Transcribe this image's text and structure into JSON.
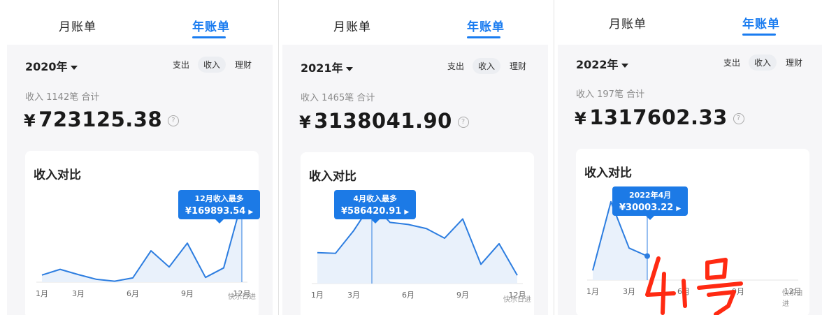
{
  "colors": {
    "accent": "#1a7cf0",
    "line": "#2c7de0",
    "fill": "#e9f1fb",
    "handwriting": "#ff2a12"
  },
  "panels": [
    {
      "tabs": [
        "月账单",
        "年账单"
      ],
      "year": "2020年",
      "segments": [
        "支出",
        "收入",
        "理财"
      ],
      "active_segment": "收入",
      "summary": "收入 1142笔 合计",
      "yen": "¥",
      "total": "723125.38",
      "help": "?",
      "card_title": "收入对比",
      "tooltip_title": "12月收入最多",
      "tooltip_value": "¥169893.54",
      "tooltip_arrow": "▶",
      "watermark": "快乐日进"
    },
    {
      "tabs": [
        "月账单",
        "年账单"
      ],
      "year": "2021年",
      "segments": [
        "支出",
        "收入",
        "理财"
      ],
      "active_segment": "收入",
      "summary": "收入 1465笔 合计",
      "yen": "¥",
      "total": "3138041.90",
      "help": "?",
      "card_title": "收入对比",
      "tooltip_title": "4月收入最多",
      "tooltip_value": "¥586420.91",
      "tooltip_arrow": "▶",
      "watermark": "快乐日进"
    },
    {
      "tabs": [
        "月账单",
        "年账单"
      ],
      "year": "2022年",
      "segments": [
        "支出",
        "收入",
        "理财"
      ],
      "active_segment": "收入",
      "summary": "收入 197笔 合计",
      "yen": "¥",
      "total": "1317602.33",
      "help": "?",
      "card_title": "收入对比",
      "tooltip_title": "2022年4月",
      "tooltip_value": "¥30003.22",
      "tooltip_arrow": "▶",
      "watermark": "快乐日进",
      "handwritten_note": "4.1号"
    }
  ],
  "chart_data": [
    {
      "type": "area",
      "x": [
        "1月",
        "2月",
        "3月",
        "4月",
        "5月",
        "6月",
        "7月",
        "8月",
        "9月",
        "10月",
        "11月",
        "12月"
      ],
      "x_ticks": [
        "1月",
        "3月",
        "6月",
        "9月",
        "12月"
      ],
      "values": [
        15000,
        27000,
        16000,
        6000,
        2000,
        9000,
        66000,
        32000,
        82000,
        10000,
        30000,
        169893.54
      ],
      "highlight_index": 11,
      "ylim": [
        0,
        185000
      ]
    },
    {
      "type": "area",
      "x": [
        "1月",
        "2月",
        "3月",
        "4月",
        "5月",
        "6月",
        "7月",
        "8月",
        "9月",
        "10月",
        "11月",
        "12月"
      ],
      "x_ticks": [
        "1月",
        "3月",
        "6月",
        "9月",
        "12月"
      ],
      "values": [
        225000,
        220000,
        385000,
        586420.91,
        445000,
        430000,
        400000,
        330000,
        470000,
        140000,
        290000,
        60000
      ],
      "highlight_index": 3,
      "ylim": [
        0,
        640000
      ]
    },
    {
      "type": "area",
      "x": [
        "1月",
        "2月",
        "3月",
        "4月"
      ],
      "x_ticks": [
        "1月",
        "3月",
        "6月",
        "9月",
        "12月"
      ],
      "values": [
        12000,
        98000,
        40000,
        30003.22
      ],
      "highlight_index": 3,
      "ylim": [
        0,
        110000
      ]
    }
  ]
}
